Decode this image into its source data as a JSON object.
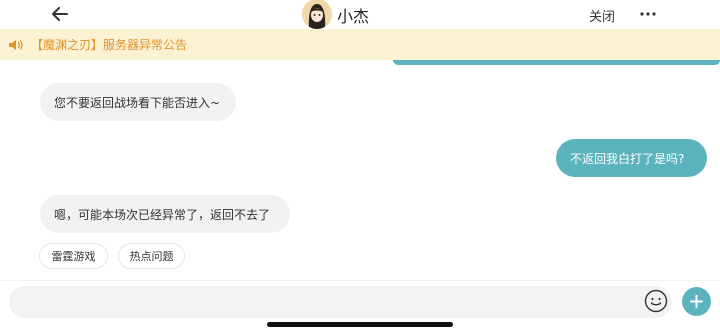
{
  "header": {
    "back_icon": "arrow-left-icon",
    "title": "小杰",
    "close_label": "关闭",
    "more_icon": "more-horizontal-icon"
  },
  "notice": {
    "icon": "speaker-icon",
    "text": "【魔渊之刃】服务器异常公告",
    "color": "#e3922a"
  },
  "messages": [
    {
      "side": "left",
      "text": "您不要返回战场看下能否进入~"
    },
    {
      "side": "right",
      "text": "不返回我白打了是吗?"
    },
    {
      "side": "left",
      "text": "嗯，可能本场次已经异常了，返回不去了"
    }
  ],
  "quick_replies": [
    "雷霆游戏",
    "热点问题"
  ],
  "input": {
    "value": "",
    "emoji_icon": "emoji-icon",
    "plus_icon": "plus-icon"
  },
  "colors": {
    "accent": "#5bb4bd",
    "notice_bg": "#fbf1d3"
  }
}
